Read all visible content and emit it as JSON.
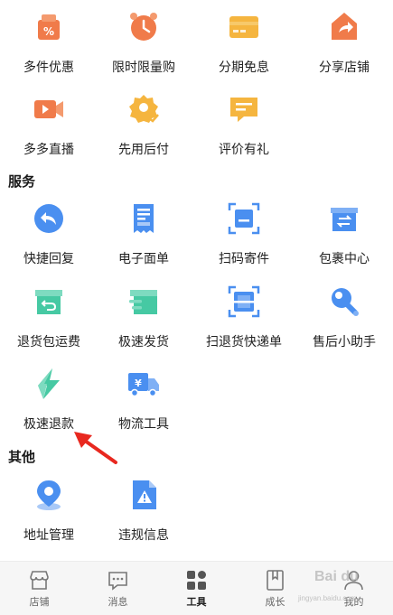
{
  "rows": [
    {
      "items": [
        {
          "label": "多件优惠",
          "icon": "discount-bag-icon"
        },
        {
          "label": "限时限量购",
          "icon": "alarm-clock-icon"
        },
        {
          "label": "分期免息",
          "icon": "credit-card-icon"
        },
        {
          "label": "分享店铺",
          "icon": "share-store-icon"
        }
      ]
    },
    {
      "items": [
        {
          "label": "多多直播",
          "icon": "video-camera-icon"
        },
        {
          "label": "先用后付",
          "icon": "badge-check-icon"
        },
        {
          "label": "评价有礼",
          "icon": "review-message-icon"
        }
      ]
    }
  ],
  "sections": {
    "service": {
      "title": "服务",
      "rows": [
        {
          "items": [
            {
              "label": "快捷回复",
              "icon": "quick-reply-icon"
            },
            {
              "label": "电子面单",
              "icon": "receipt-icon"
            },
            {
              "label": "扫码寄件",
              "icon": "scan-ship-icon"
            },
            {
              "label": "包裹中心",
              "icon": "parcel-box-icon"
            }
          ]
        },
        {
          "items": [
            {
              "label": "退货包运费",
              "icon": "return-box-icon"
            },
            {
              "label": "极速发货",
              "icon": "fast-ship-icon"
            },
            {
              "label": "扫退货快递单",
              "icon": "scan-return-icon"
            },
            {
              "label": "售后小助手",
              "icon": "wrench-icon"
            }
          ]
        },
        {
          "items": [
            {
              "label": "极速退款",
              "icon": "lightning-icon"
            },
            {
              "label": "物流工具",
              "icon": "delivery-truck-icon"
            }
          ]
        }
      ]
    },
    "other": {
      "title": "其他",
      "rows": [
        {
          "items": [
            {
              "label": "地址管理",
              "icon": "location-pin-icon"
            },
            {
              "label": "违规信息",
              "icon": "warning-document-icon"
            }
          ]
        }
      ]
    }
  },
  "tabbar": [
    {
      "label": "店铺",
      "icon": "store-icon",
      "active": false
    },
    {
      "label": "消息",
      "icon": "message-icon",
      "active": false
    },
    {
      "label": "工具",
      "icon": "tools-grid-icon",
      "active": true
    },
    {
      "label": "成长",
      "icon": "book-icon",
      "active": false
    },
    {
      "label": "我的",
      "icon": "user-icon",
      "active": false
    }
  ],
  "colors": {
    "orange": "#f07b4a",
    "yellow": "#f5b53f",
    "blue": "#4a8ff0",
    "green": "#46c9a3",
    "red_arrow": "#e8281f"
  },
  "watermark": {
    "logo": "Bai du",
    "sub": "jingyan.baidu.com"
  }
}
